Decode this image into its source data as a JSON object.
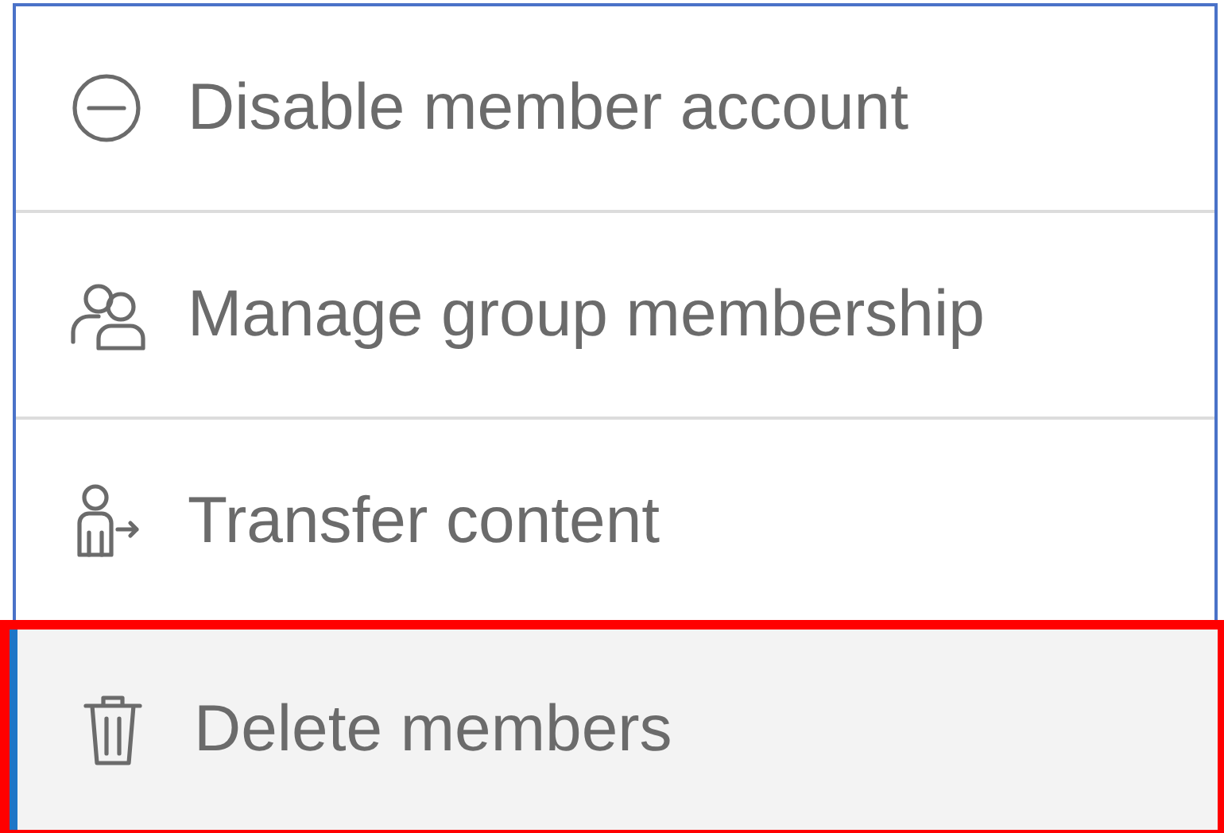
{
  "menu": {
    "items": [
      {
        "kind": "disable",
        "label": "Disable member account",
        "selected": false,
        "outlined": false
      },
      {
        "kind": "groups",
        "label": "Manage group membership",
        "selected": false,
        "outlined": false
      },
      {
        "kind": "transfer",
        "label": "Transfer content",
        "selected": false,
        "outlined": false
      },
      {
        "kind": "delete",
        "label": "Delete members",
        "selected": true,
        "outlined": true
      }
    ]
  }
}
